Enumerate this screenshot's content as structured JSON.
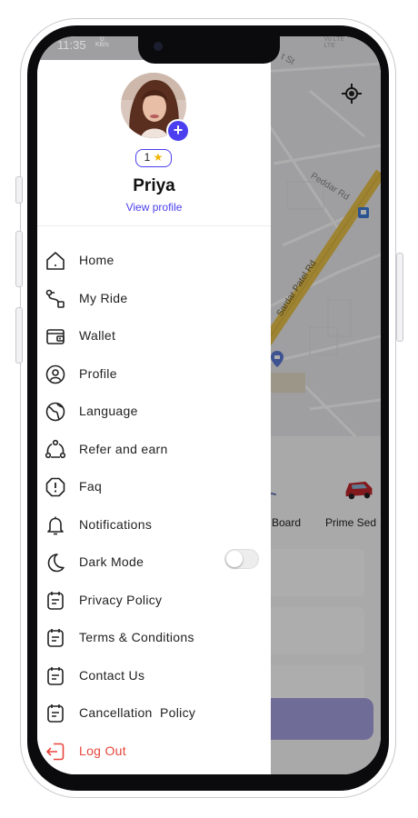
{
  "status_bar": {
    "time": "11:35",
    "speed_value": "0",
    "speed_unit": "KB/s",
    "network_1": "Vo LTE",
    "network_2": "LTE"
  },
  "map": {
    "street_labels": [
      "Peddar Rd",
      "Sardar Patel Rd",
      "t St"
    ],
    "icons": [
      "gps-target-icon",
      "bus-stop-icon",
      "location-pin-icon"
    ]
  },
  "vehicles": [
    {
      "label": "Board",
      "icon": "scooter-icon"
    },
    {
      "label": "Prime Sed",
      "icon": "red-car-icon"
    }
  ],
  "profile": {
    "rating": "1",
    "name": "Priya",
    "view_profile_label": "View profile"
  },
  "menu": [
    {
      "label": "Home",
      "icon": "home-icon"
    },
    {
      "label": "My Ride",
      "icon": "route-icon"
    },
    {
      "label": "Wallet",
      "icon": "wallet-icon"
    },
    {
      "label": "Profile",
      "icon": "user-circle-icon"
    },
    {
      "label": "Language",
      "icon": "globe-icon"
    },
    {
      "label": "Refer and earn",
      "icon": "share-network-icon"
    },
    {
      "label": "Faq",
      "icon": "alert-circle-icon"
    },
    {
      "label": "Notifications",
      "icon": "bell-icon"
    },
    {
      "label": "Dark Mode",
      "icon": "moon-icon",
      "toggle_on": false
    },
    {
      "label": "Privacy Policy",
      "icon": "document-icon"
    },
    {
      "label": "Terms & Conditions",
      "icon": "document-icon"
    },
    {
      "label": "Contact Us",
      "icon": "document-icon"
    },
    {
      "label": "Cancellation  Policy",
      "icon": "document-icon"
    },
    {
      "label": "Log Out",
      "icon": "logout-icon"
    }
  ],
  "colors": {
    "accent": "#4b3ff0",
    "danger": "#e8453c",
    "road": "#e8c24a"
  }
}
